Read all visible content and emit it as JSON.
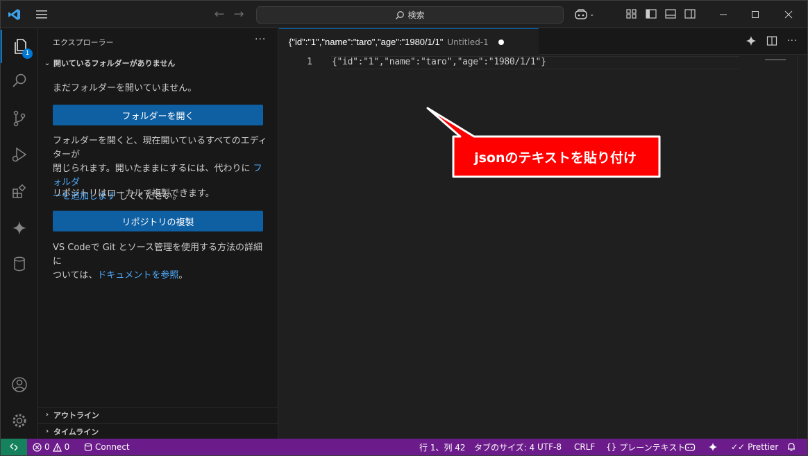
{
  "titlebar": {
    "search_placeholder": "検索"
  },
  "activity": {
    "explorer_badge": "1"
  },
  "sidebar": {
    "title": "エクスプローラー",
    "more": "···",
    "section": "開いているフォルダーがありません",
    "no_folder_text": "まだフォルダーを開いていません。",
    "open_folder_button": "フォルダーを開く",
    "info_text_1": "フォルダーを開くと、現在開いているすべてのエディターが",
    "info_text_2": "閉じられます。開いたままにするには、代わりに ",
    "info_link_1": "フォルダ",
    "info_link_2": "ーを追加します",
    "info_text_3": " してください。",
    "repo_text": "リポジトリはローカルで複製できます。",
    "clone_button": "リポジトリの複製",
    "git_text_1": "VS Codeで Git とソース管理を使用する方法の詳細に",
    "git_text_2": "ついては、",
    "git_link": "ドキュメントを参照",
    "git_text_3": "。",
    "outline": "アウトライン",
    "timeline": "タイムライン"
  },
  "editor": {
    "tab_title": "{\"id\":\"1\",\"name\":\"taro\",\"age\":\"1980/1/1\"",
    "tab_desc": "Untitled-1",
    "line_number": "1",
    "code": "{\"id\":\"1\",\"name\":\"taro\",\"age\":\"1980/1/1\"}"
  },
  "callout": {
    "text": "jsonのテキストを貼り付け",
    "fill": "#ff0000",
    "border": "#ffffff"
  },
  "status": {
    "errors": "0",
    "warnings": "0",
    "connect": "Connect",
    "position": "行 1、列 42",
    "tab_size": "タブのサイズ: 4",
    "encoding": "UTF-8",
    "eol": "CRLF",
    "language": "プレーンテキスト",
    "prettier": "Prettier"
  },
  "colors": {
    "accent": "#0078d4",
    "statusbar": "#6c1c8a",
    "remote": "#16825d",
    "button": "#0f5fa3",
    "link": "#4daafc"
  }
}
